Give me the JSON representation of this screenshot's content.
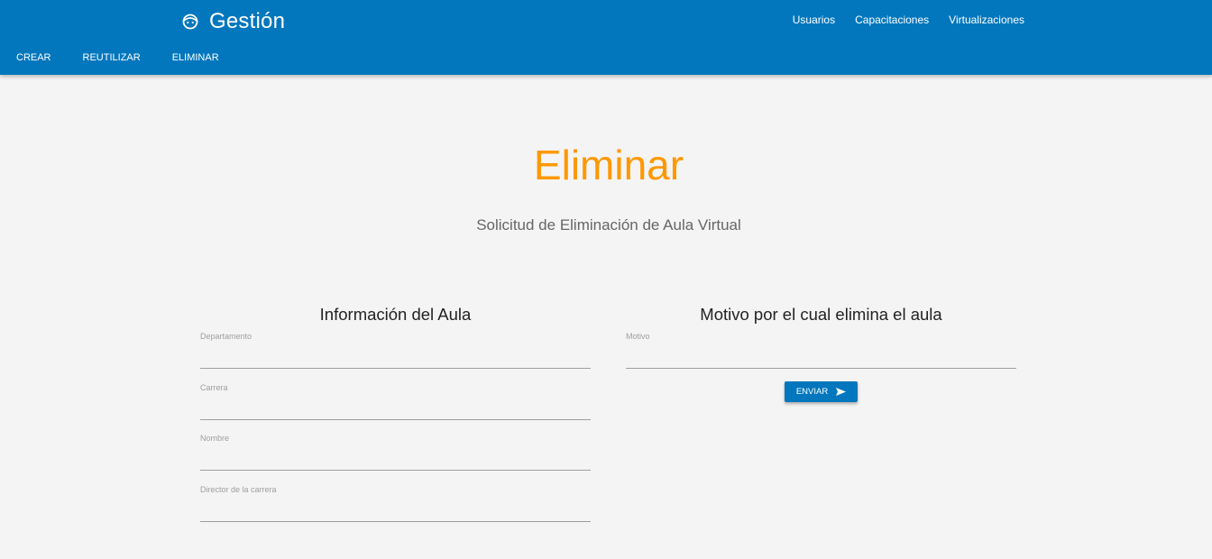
{
  "navbar": {
    "brand": {
      "icon": "face-icon",
      "label": "Gestión"
    },
    "links": [
      "Usuarios",
      "Capacitaciones",
      "Virtualizaciones"
    ],
    "tabs": [
      "CREAR",
      "REUTILIZAR",
      "ELIMINAR"
    ],
    "color": "#0277bd"
  },
  "page": {
    "title": "Eliminar",
    "subtitle": "Solicitud de Eliminación de Aula Virtual",
    "title_color": "#ff9800"
  },
  "aula_section": {
    "heading": "Información del Aula",
    "fields": [
      {
        "label": "Departamento",
        "value": ""
      },
      {
        "label": "Carrera",
        "value": ""
      },
      {
        "label": "Nombre",
        "value": ""
      },
      {
        "label": "Director de la carrera",
        "value": ""
      }
    ]
  },
  "motivo_section": {
    "heading": "Motivo por el cual elimina el aula",
    "field": {
      "label": "Motivo",
      "value": ""
    },
    "submit": {
      "label": "ENVIAR",
      "icon": "send-icon"
    }
  }
}
